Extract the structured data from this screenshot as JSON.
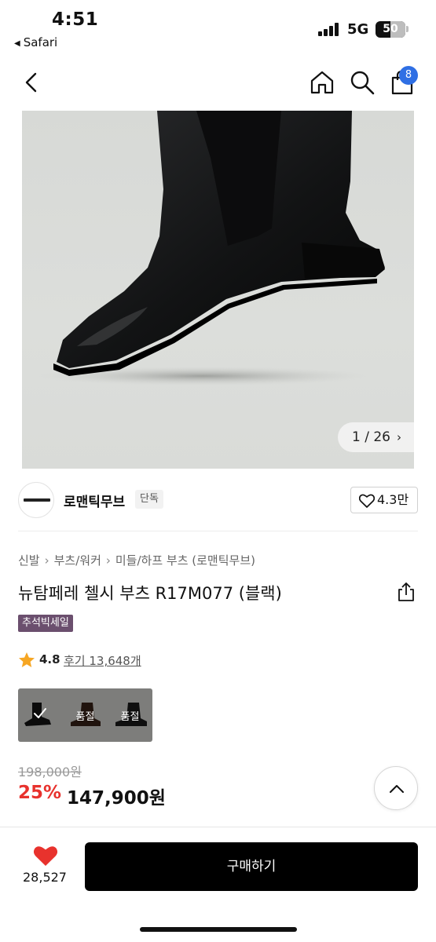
{
  "status_bar": {
    "time": "4:51",
    "back_app": "Safari",
    "network": "5G",
    "battery": "50"
  },
  "nav": {
    "back_icon": "chevron-left-icon",
    "home_icon": "home-icon",
    "search_icon": "search-icon",
    "cart_icon": "shopping-bag-icon",
    "cart_count": "8"
  },
  "gallery": {
    "counter": "1 / 26"
  },
  "brand": {
    "name": "로맨틱무브",
    "exclusive_label": "단독",
    "likes": "4.3만"
  },
  "product": {
    "breadcrumb": [
      "신발",
      "부츠/워커",
      "미들/하프 부츠 (로맨틱무브)"
    ],
    "title": "뉴탐페레 첼시 부츠 R17M077 (블랙)",
    "tag": "추석빅세일",
    "rating": "4.8",
    "reviews": "후기 13,648개",
    "options": [
      {
        "color": "black",
        "status": "selected"
      },
      {
        "color": "brown",
        "status": "품절"
      },
      {
        "color": "black-suede",
        "status": "품절"
      }
    ],
    "original_price": "198,000원",
    "discount": "25%",
    "price": "147,900원"
  },
  "bottom_bar": {
    "like_count": "28,527",
    "buy_label": "구매하기"
  },
  "colors": {
    "accent_red": "#e8322d",
    "badge_blue": "#2f6fe4",
    "tag_purple": "#6b4f6e",
    "buy_button": "#000000"
  }
}
